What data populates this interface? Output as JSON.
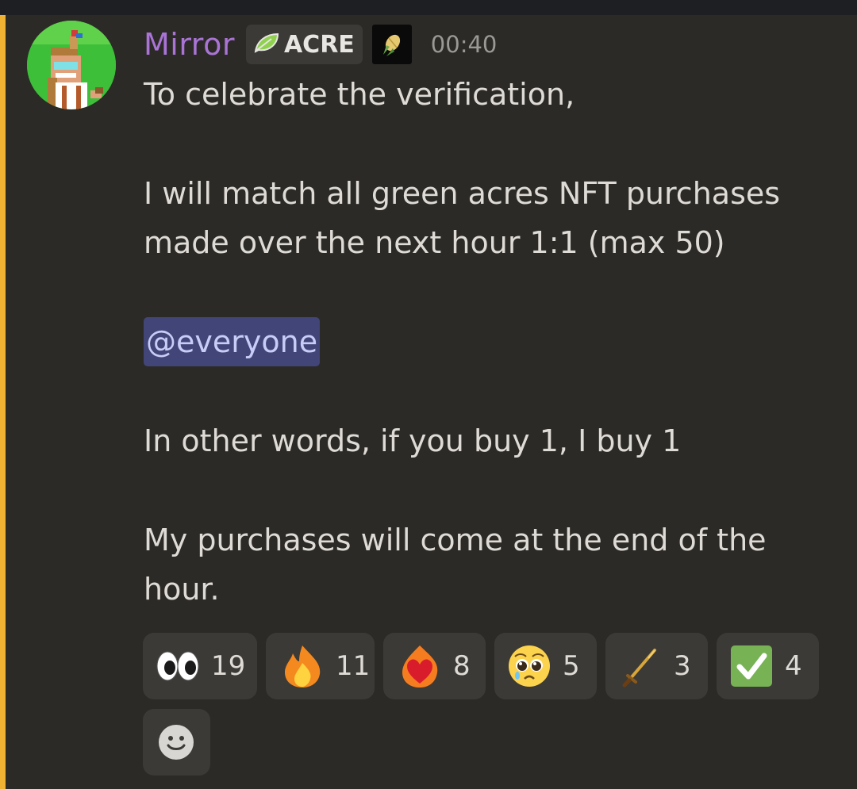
{
  "message": {
    "author": "Mirror",
    "role_tag": "ACRE",
    "timestamp": "00:40",
    "lines": {
      "l1": "To celebrate the verification,",
      "l2": "I will match all green acres NFT purchases made over the next hour 1:1 (max 50)",
      "mention": "@everyone",
      "l3": "In other words, if you buy 1, I buy 1",
      "l4": "My purchases will come at the end of the hour."
    }
  },
  "reactions": [
    {
      "icon": "eyes-icon",
      "count": "19"
    },
    {
      "icon": "fire-icon",
      "count": "11"
    },
    {
      "icon": "heart-on-fire-icon",
      "count": "8"
    },
    {
      "icon": "pleading-face-icon",
      "count": "5"
    },
    {
      "icon": "sword-icon",
      "count": "3"
    },
    {
      "icon": "check-mark-icon",
      "count": "4"
    }
  ],
  "colors": {
    "username": "#a974d6",
    "accent_bar": "#f0b232",
    "mention_bg": "#424577",
    "background": "#2c2a26"
  }
}
